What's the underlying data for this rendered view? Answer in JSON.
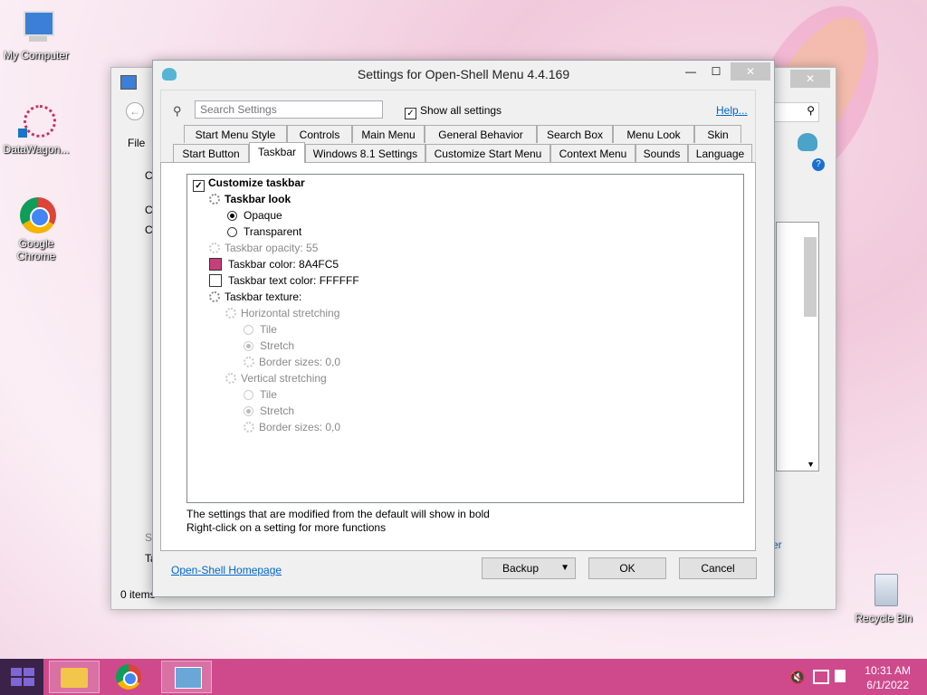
{
  "desktop": {
    "icons": [
      {
        "label": "My Computer"
      },
      {
        "label": "DataWagon..."
      },
      {
        "label": "Google Chrome"
      },
      {
        "label": "Recycle Bin"
      }
    ]
  },
  "explorer": {
    "menu_file": "File",
    "status": "0 items",
    "partial_texts": [
      "C",
      "C",
      "C",
      "Se",
      "Ta",
      "er"
    ]
  },
  "dialog": {
    "title": "Settings for Open-Shell Menu 4.4.169",
    "search_placeholder": "Search Settings",
    "show_all_label": "Show all settings",
    "show_all_checked": true,
    "help_link": "Help...",
    "tabs_row1": [
      "Start Menu Style",
      "Controls",
      "Main Menu",
      "General Behavior",
      "Search Box",
      "Menu Look",
      "Skin"
    ],
    "tabs_row2": [
      "Start Button",
      "Taskbar",
      "Windows 8.1 Settings",
      "Customize Start Menu",
      "Context Menu",
      "Sounds",
      "Language"
    ],
    "active_tab": "Taskbar",
    "tree": {
      "customize_taskbar": "Customize taskbar",
      "taskbar_look": "Taskbar look",
      "opaque": "Opaque",
      "transparent": "Transparent",
      "opacity": "Taskbar opacity: 55",
      "color": "Taskbar color: 8A4FC5",
      "color_hex": "#8A4FC5",
      "swatch_color": "#c5407a",
      "text_color": "Taskbar text color: FFFFFF",
      "text_color_hex": "#FFFFFF",
      "texture": "Taskbar texture:",
      "h_stretch": "Horizontal stretching",
      "tile": "Tile",
      "stretch": "Stretch",
      "border_sizes": "Border sizes: 0,0",
      "v_stretch": "Vertical stretching"
    },
    "hint1": "The settings that are modified from the default will show in bold",
    "hint2": "Right-click on a setting for more functions",
    "homepage_link": "Open-Shell Homepage",
    "backup_label": "Backup",
    "ok_label": "OK",
    "cancel_label": "Cancel"
  },
  "taskbar": {
    "time": "10:31 AM",
    "date": "6/1/2022",
    "color": "#cf4a8c"
  }
}
